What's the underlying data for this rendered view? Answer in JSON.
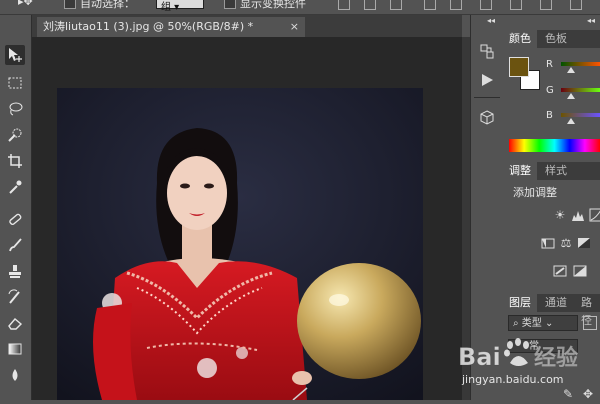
{
  "options_bar": {
    "auto_select_label": "自动选择：",
    "auto_select_value": "组",
    "show_transform_label": "显示变换控件"
  },
  "document": {
    "tab_title": "刘涛liutao11 (3).jpg @ 50%(RGB/8#) *",
    "close_glyph": "×"
  },
  "color_panel": {
    "tabs": [
      "颜色",
      "色板"
    ],
    "channels": [
      "R",
      "G",
      "B"
    ],
    "foreground_color": "#6b5310",
    "background_color": "#ffffff"
  },
  "adjustments_panel": {
    "tabs": [
      "调整",
      "样式"
    ],
    "add_adjustment": "添加调整"
  },
  "layers_panel": {
    "tabs": [
      "图层",
      "通道",
      "路径"
    ],
    "filter_kind": "类型",
    "mode_partial": "常"
  },
  "watermark": {
    "brand": "Bai度经验",
    "url": "jingyan.baidu.com"
  },
  "collapse_glyph": "◂◂"
}
